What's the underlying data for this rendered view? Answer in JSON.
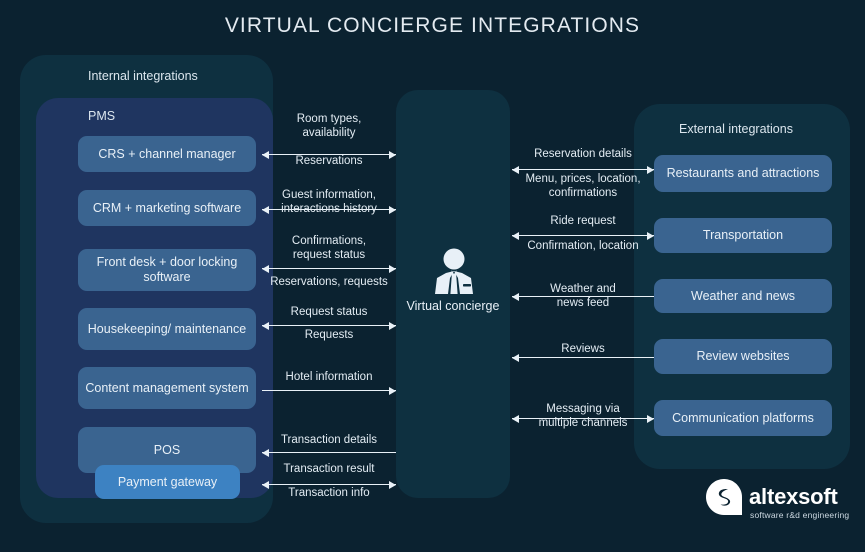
{
  "title": "VIRTUAL CONCIERGE INTEGRATIONS",
  "colors": {
    "background": "#0b2230",
    "panel": "#0e3040",
    "pms_panel": "#1f3560",
    "box": "#3a6490",
    "box_highlight": "#3d82c2",
    "text": "#e8f0f7",
    "arrow": "#e9f1f7"
  },
  "panels": {
    "internal_label": "Internal integrations",
    "pms_label": "PMS",
    "external_label": "External integrations"
  },
  "center": {
    "icon": "business-person-icon",
    "label": "Virtual concierge"
  },
  "internal_boxes": [
    {
      "label": "CRS + channel manager",
      "highlight": false
    },
    {
      "label": "CRM + marketing\nsoftware",
      "highlight": false
    },
    {
      "label": "Front desk + door\nlocking software",
      "highlight": false
    },
    {
      "label": "Housekeeping/\nmaintenance",
      "highlight": false
    },
    {
      "label": "Content management\nsystem",
      "highlight": false
    },
    {
      "label": "POS",
      "highlight": false
    },
    {
      "label": "Payment gateway",
      "highlight": true
    }
  ],
  "external_boxes": [
    {
      "label": "Restaurants and\nattractions"
    },
    {
      "label": "Transportation"
    },
    {
      "label": "Weather and news"
    },
    {
      "label": "Review websites"
    },
    {
      "label": "Communication\nplatforms"
    }
  ],
  "left_flows": [
    {
      "label": "Room types,\navailability",
      "direction": "right"
    },
    {
      "label": "Reservations",
      "direction": "left"
    },
    {
      "label": "Guest information,\ninteractions history",
      "direction": "both"
    },
    {
      "label": "Confirmations,\nrequest status",
      "direction": "right"
    },
    {
      "label": "Reservations, requests",
      "direction": "left"
    },
    {
      "label": "Request status",
      "direction": "right"
    },
    {
      "label": "Requests",
      "direction": "left"
    },
    {
      "label": "Hotel information",
      "direction": "right"
    },
    {
      "label": "Transaction details",
      "direction": "left"
    },
    {
      "label": "Transaction result",
      "direction": "right"
    },
    {
      "label": "Transaction info",
      "direction": "left"
    }
  ],
  "right_flows": [
    {
      "label": "Reservation details",
      "direction": "right"
    },
    {
      "label": "Menu, prices, location,\nconfirmations",
      "direction": "left"
    },
    {
      "label": "Ride request",
      "direction": "right"
    },
    {
      "label": "Confirmation, location",
      "direction": "left"
    },
    {
      "label": "Weather and\nnews feed",
      "direction": "left"
    },
    {
      "label": "Reviews",
      "direction": "left"
    },
    {
      "label": "Messaging via\nmultiple channels",
      "direction": "both"
    }
  ],
  "logo": {
    "name": "altexsoft",
    "tagline": "software r&d engineering"
  }
}
